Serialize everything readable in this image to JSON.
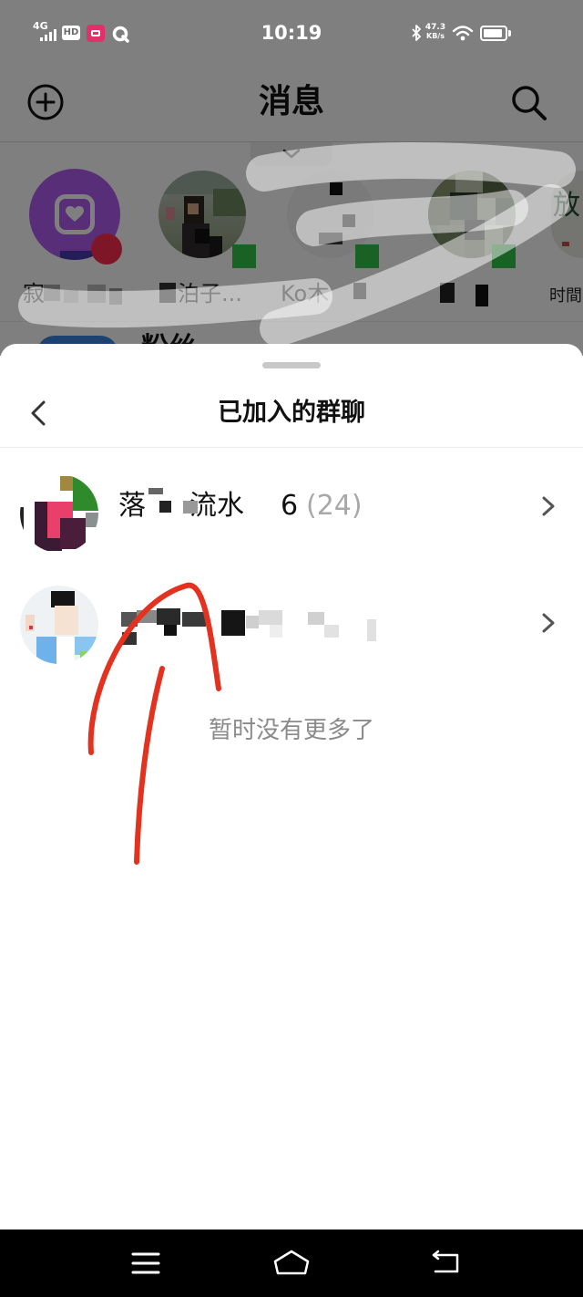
{
  "status_bar": {
    "network": "4G",
    "hd_badge": "HD",
    "time": "10:19",
    "net_speed": "47.3",
    "net_speed_unit": "KB/s",
    "battery_percent": 90,
    "icons": [
      "signal-icon",
      "app-notification-icon",
      "sync-icon",
      "bluetooth-icon",
      "wifi-icon",
      "battery-icon"
    ]
  },
  "header": {
    "title": "消息",
    "left_icon": "plus-circle-icon",
    "right_icon": "search-icon",
    "expand_icon": "chevron-down-icon"
  },
  "contacts": [
    {
      "label": "寂",
      "avatar_icon": "heart-square-icon",
      "unread_dot": true
    },
    {
      "label": "泊子...",
      "online_badge": true
    },
    {
      "label": "Ko木",
      "online_badge": true
    },
    {
      "online_badge": true
    },
    {
      "label": "时間",
      "avatar_text": "放"
    }
  ],
  "next_section": {
    "title": "粉丝"
  },
  "sheet": {
    "title": "已加入的群聊",
    "back_icon": "chevron-left-icon",
    "groups": [
      {
        "name_start": "落",
        "name_end": "流水",
        "member_count": "6",
        "total_count": "(24)",
        "chevron": "chevron-right-icon"
      },
      {
        "chevron": "chevron-right-icon"
      }
    ],
    "end_text": "暂时没有更多了"
  },
  "nav_bar": {
    "icons": [
      "menu-icon",
      "home-icon",
      "back-icon"
    ]
  },
  "colors": {
    "annotation_red": "#e3321f",
    "unread_red": "#ff2d4f",
    "online_green": "#34c24b",
    "avatar_purple": "#b25cf2",
    "secondary_text": "#a8a8a8"
  }
}
